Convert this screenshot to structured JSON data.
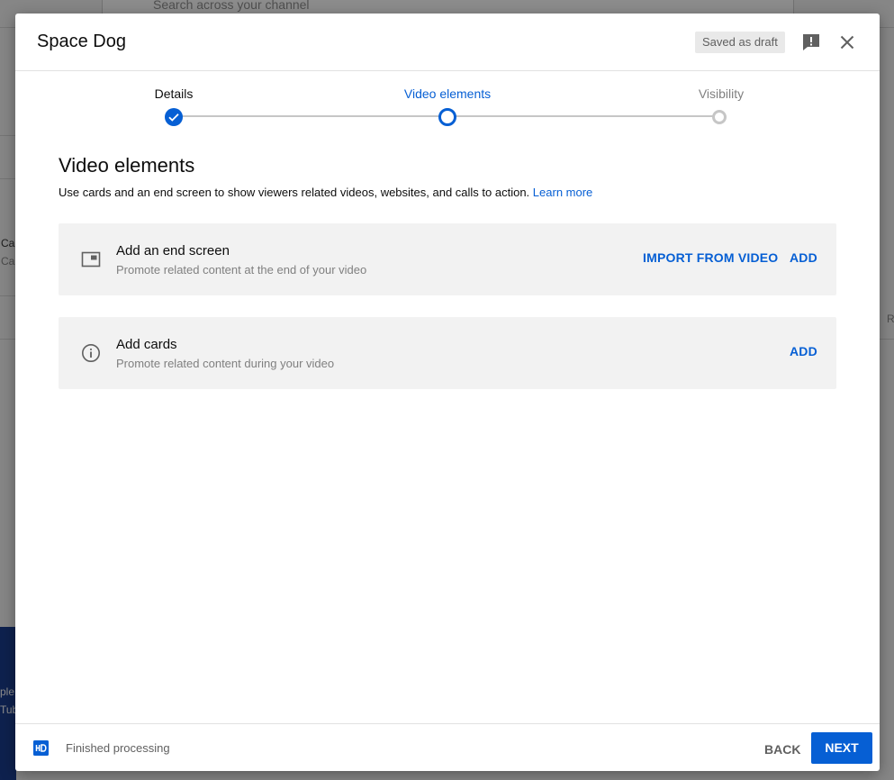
{
  "background": {
    "search_placeholder": "Search across your channel",
    "frag_1": "Ca",
    "frag_2": "Ca",
    "frag_3": "R",
    "frag_4": "ple",
    "frag_5": "Tub"
  },
  "dialog": {
    "title": "Space Dog",
    "draft_badge": "Saved as draft",
    "icons": {
      "feedback": "feedback-icon",
      "close": "close-icon"
    }
  },
  "stepper": {
    "steps": [
      {
        "label": "Details",
        "state": "completed"
      },
      {
        "label": "Video elements",
        "state": "current"
      },
      {
        "label": "Visibility",
        "state": "upcoming"
      }
    ],
    "colors": {
      "active": "#065fd4",
      "inactive": "#c6c6c6"
    }
  },
  "content": {
    "title": "Video elements",
    "description": "Use cards and an end screen to show viewers related videos, websites, and calls to action.",
    "learn_more": "Learn more",
    "end_screen": {
      "title": "Add an end screen",
      "subtitle": "Promote related content at the end of your video",
      "import_label": "IMPORT FROM VIDEO",
      "add_label": "ADD",
      "icon": "end-screen-icon"
    },
    "cards": {
      "title": "Add cards",
      "subtitle": "Promote related content during your video",
      "add_label": "ADD",
      "icon": "info-icon"
    }
  },
  "footer": {
    "status": "Finished processing",
    "hd_icon": "hd-icon",
    "back_label": "BACK",
    "next_label": "NEXT"
  }
}
